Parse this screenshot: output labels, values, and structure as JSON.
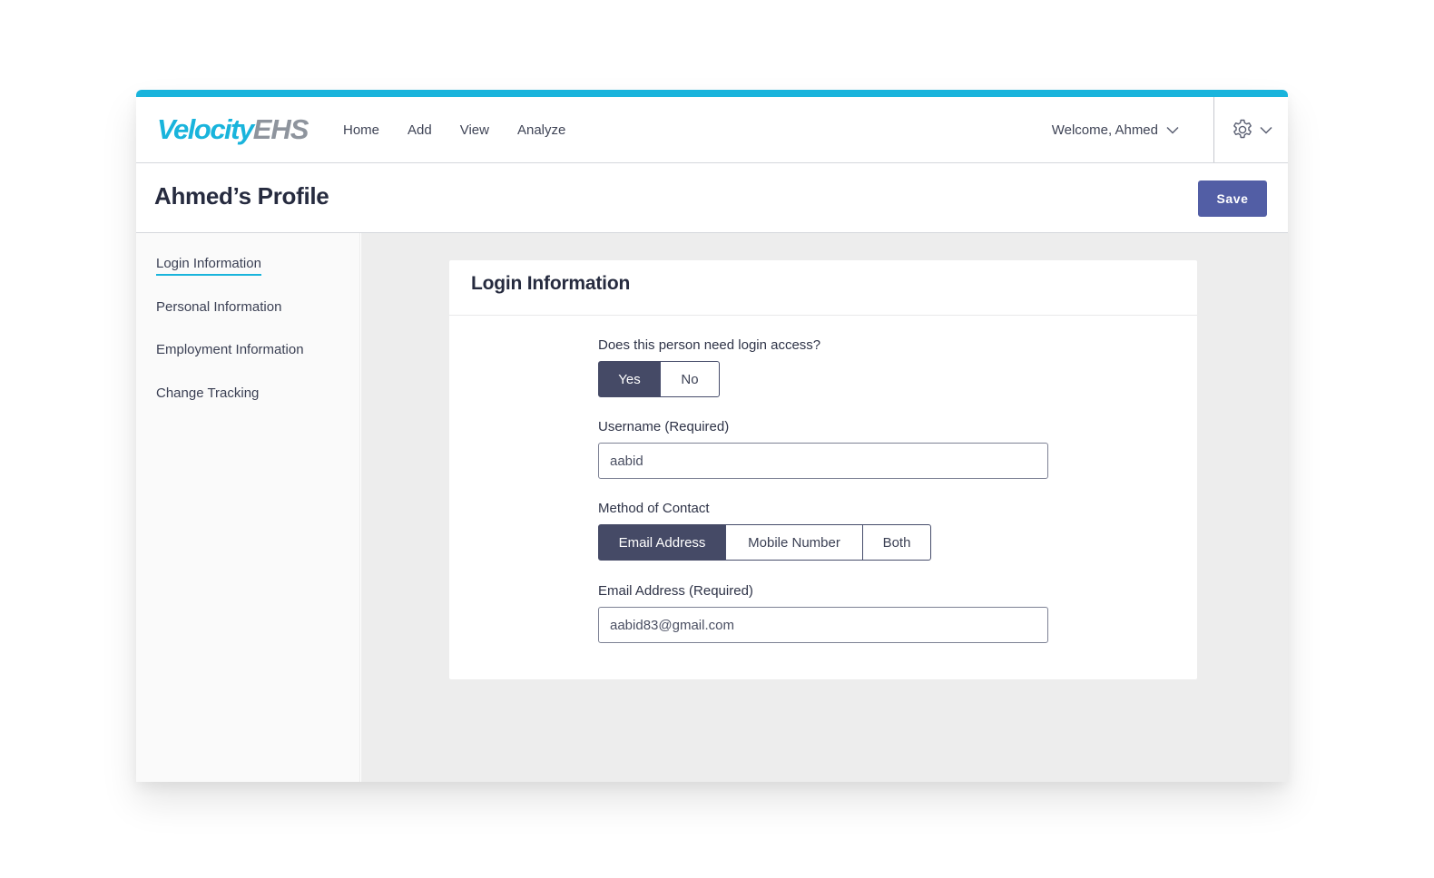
{
  "brand": {
    "logo_primary": "Velocity",
    "logo_secondary": "EHS",
    "accent_color": "#19b4dc",
    "primary_color": "#525ea5"
  },
  "nav": {
    "links": [
      {
        "label": "Home"
      },
      {
        "label": "Add"
      },
      {
        "label": "View"
      },
      {
        "label": "Analyze"
      }
    ],
    "welcome": "Welcome, Ahmed",
    "welcome_icon": "chevron-down-icon",
    "settings_icon": "gear-icon"
  },
  "page": {
    "title": "Ahmed’s Profile",
    "save_label": "Save"
  },
  "sidebar": {
    "items": [
      {
        "label": "Login Information",
        "active": true
      },
      {
        "label": "Personal Information",
        "active": false
      },
      {
        "label": "Employment Information",
        "active": false
      },
      {
        "label": "Change Tracking",
        "active": false
      }
    ]
  },
  "form": {
    "title": "Login Information",
    "login_access": {
      "label": "Does this person need login access?",
      "options": [
        "Yes",
        "No"
      ],
      "selected": "Yes"
    },
    "username": {
      "label": "Username (Required)",
      "value": "aabid"
    },
    "contact_method": {
      "label": "Method of Contact",
      "options": [
        "Email Address",
        "Mobile Number",
        "Both"
      ],
      "selected": "Email Address"
    },
    "email": {
      "label": "Email Address (Required)",
      "value": "aabid83@gmail.com"
    }
  }
}
